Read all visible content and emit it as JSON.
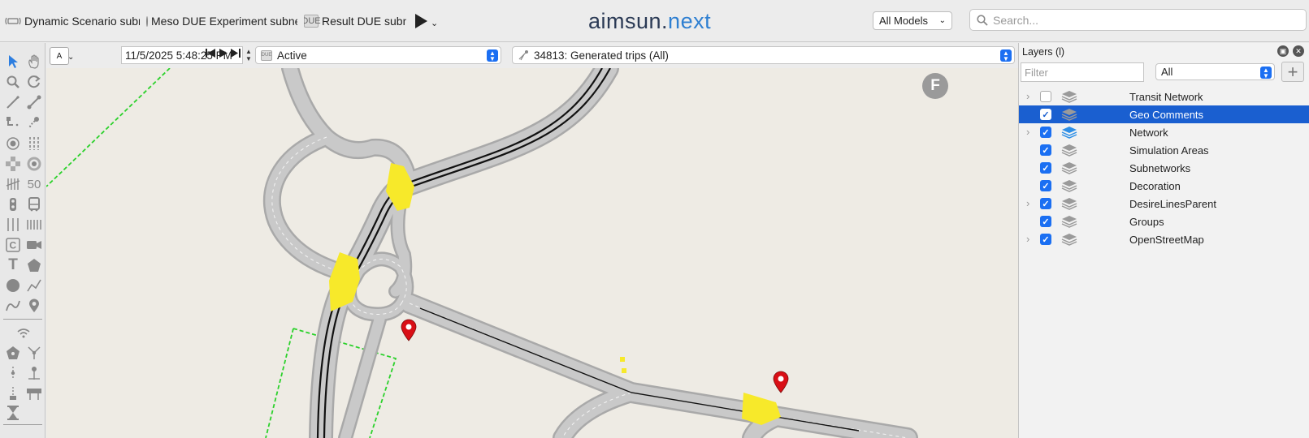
{
  "toolbar": {
    "items": [
      {
        "icon": "dynamic-scenario-icon",
        "label": "Dynamic Scenario subne"
      },
      {
        "icon": "radio-icon",
        "label": "Meso DUE Experiment subne"
      },
      {
        "icon": "due-icon",
        "label": "Result DUE subne"
      }
    ],
    "due_icon_text": "DUE",
    "play_menu_arrow": "⌄"
  },
  "logo": {
    "part1": "aimsun.",
    "part2": "next"
  },
  "models": {
    "value": "All Models",
    "arrow": "⌄"
  },
  "search": {
    "placeholder": "Search..."
  },
  "viewbar": {
    "mode_button": "A",
    "mode_arrow": "⌄",
    "datetime": "11/5/2025 5:48:25 PM",
    "status_select": "Active",
    "status_icon_text": "DUE",
    "od_select": "34813: Generated trips (All)"
  },
  "toolbox": {
    "numeric_tool": "50"
  },
  "map": {
    "badge": "F",
    "pin_color": "#d90f16",
    "highlight_color": "#f7e92a"
  },
  "layers": {
    "title": "Layers (l)",
    "filter_placeholder": "Filter",
    "filter_select": "All",
    "add_button": "+",
    "items": [
      {
        "name": "Transit Network",
        "checked": false,
        "expandable": true,
        "selected": false,
        "icon_color": "#9a9a9a"
      },
      {
        "name": "Geo Comments",
        "checked": true,
        "expandable": false,
        "selected": true,
        "icon_color": "#9a9a9a"
      },
      {
        "name": "Network",
        "checked": true,
        "expandable": true,
        "selected": false,
        "icon_color": "#2e8fe6"
      },
      {
        "name": "Simulation Areas",
        "checked": true,
        "expandable": false,
        "selected": false,
        "icon_color": "#9a9a9a"
      },
      {
        "name": "Subnetworks",
        "checked": true,
        "expandable": false,
        "selected": false,
        "icon_color": "#9a9a9a"
      },
      {
        "name": "Decoration",
        "checked": true,
        "expandable": false,
        "selected": false,
        "icon_color": "#9a9a9a"
      },
      {
        "name": "DesireLinesParent",
        "checked": true,
        "expandable": true,
        "selected": false,
        "icon_color": "#9a9a9a"
      },
      {
        "name": "Groups",
        "checked": true,
        "expandable": false,
        "selected": false,
        "icon_color": "#9a9a9a"
      },
      {
        "name": "OpenStreetMap",
        "checked": true,
        "expandable": true,
        "selected": false,
        "icon_color": "#9a9a9a"
      }
    ]
  },
  "colors": {
    "accent": "#1b6ff2",
    "selection": "#1a5fd0",
    "desire_line": "#2bd12b",
    "road": "#c3c3c3",
    "map_bg": "#eeebe4"
  }
}
